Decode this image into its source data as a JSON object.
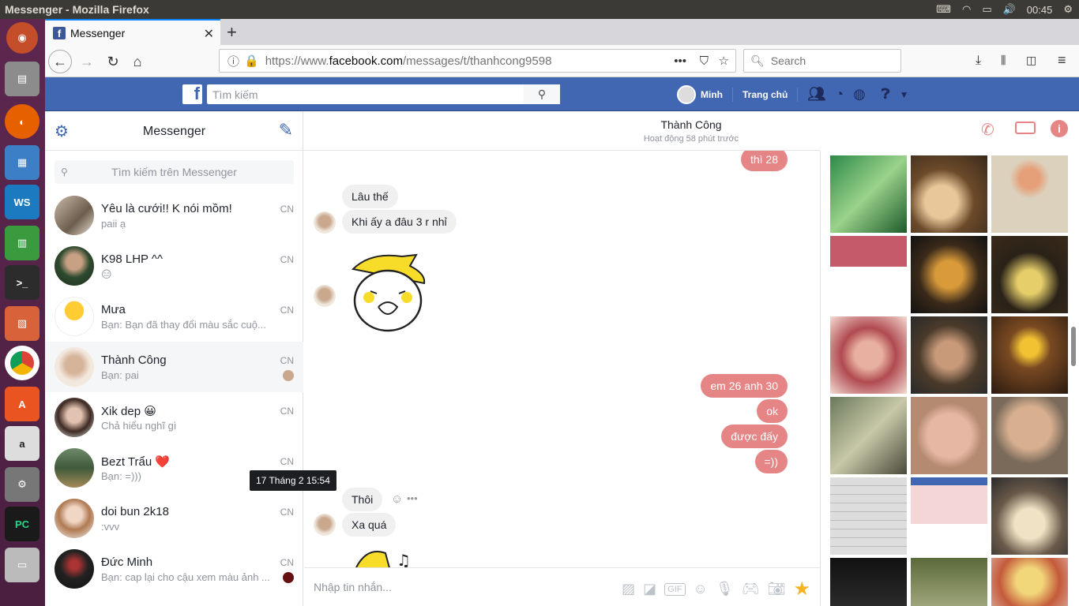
{
  "os": {
    "window_title": "Messenger - Mozilla Firefox",
    "clock": "00:45"
  },
  "browser": {
    "tab_title": "Messenger",
    "url_prefix": "https://www.",
    "url_host": "facebook.com",
    "url_path": "/messages/t/thanhcong9598",
    "search_placeholder": "Search"
  },
  "fb": {
    "search_placeholder": "Tìm kiếm",
    "user_name": "Minh",
    "home_label": "Trang chủ"
  },
  "sidebar": {
    "title": "Messenger",
    "search_placeholder": "Tìm kiếm trên Messenger",
    "conversations": [
      {
        "name": "Yêu là cưới!! K nói mồm!",
        "preview": "paii ạ",
        "time": "CN"
      },
      {
        "name": "K98 LHP ^^",
        "preview": "😑",
        "time": "CN"
      },
      {
        "name": "Mưa",
        "preview": "Bạn: Bạn đã thay đổi màu sắc cuộ...",
        "time": "CN"
      },
      {
        "name": "Thành Công",
        "preview": "Bạn: pai",
        "time": "CN"
      },
      {
        "name": "Xik dep 😀",
        "preview": "Chả hiểu nghĩ gì",
        "time": "CN"
      },
      {
        "name": "Bezt Trẩu ❤️",
        "preview": "Bạn: =)))",
        "time": "CN"
      },
      {
        "name": "doi bun 2k18",
        "preview": ":vvv",
        "time": "CN"
      },
      {
        "name": "Đức Minh",
        "preview": "Bạn: cap lại cho cậu xem màu ảnh ...",
        "time": "CN"
      }
    ]
  },
  "chat": {
    "contact_name": "Thành Công",
    "status": "Hoạt động 58 phút trước",
    "compose_placeholder": "Nhập tin nhắn...",
    "tooltip": "17 Tháng 2 15:54",
    "messages": {
      "m0": "thì 28",
      "m1": "Lâu thế",
      "m2": "Khi ấy a đâu 3 r nhỉ",
      "m3": "em 26 anh 30",
      "m4": "ok",
      "m5": "được đấy",
      "m6": "=))",
      "m7": "Thôi",
      "m8": "Xa quá"
    }
  },
  "colors": {
    "fb_blue": "#4267b2",
    "bubble_out": "#e68585",
    "bubble_in": "#f1f0f0",
    "ubuntu_launcher": "#5e2750"
  }
}
